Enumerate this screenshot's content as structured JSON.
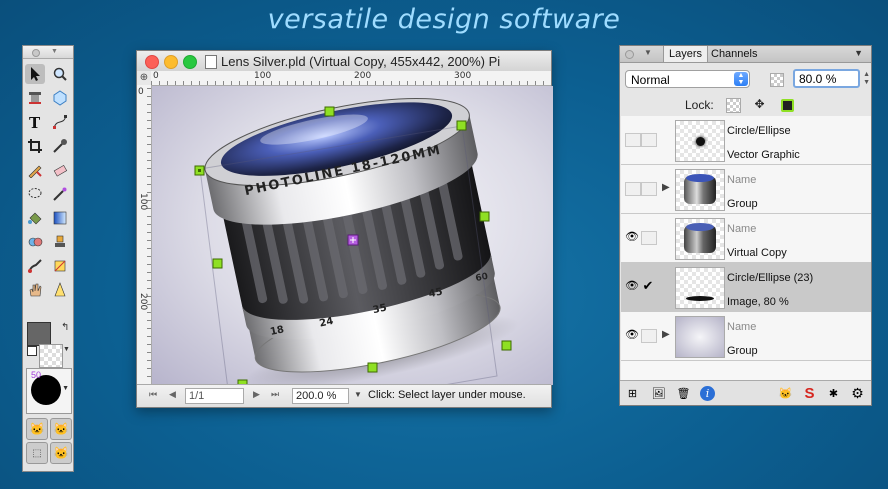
{
  "banner": "versatile design software",
  "toolbox": {
    "brush_size": "50",
    "tools": [
      "arrow-tool",
      "zoom-tool",
      "stamp-tool",
      "shape-tool",
      "text-tool",
      "node-tool",
      "crop-tool",
      "pipette-tool",
      "pencil-tool",
      "eraser-tool",
      "lasso-tool",
      "magic-wand-tool",
      "bucket-tool",
      "gradient-tool",
      "clone-tool",
      "light-tool",
      "brush-tool",
      "smudge-tool",
      "hand-tool",
      "sharpen-tool"
    ]
  },
  "document": {
    "title": "Lens Silver.pld (Virtual Copy, 455x442, 200%) Pi",
    "ruler_h_labels": [
      "0",
      "100",
      "200",
      "300"
    ],
    "ruler_v_labels": [
      "0",
      "100",
      "200"
    ],
    "page": "1/1",
    "zoom": "200.0 %",
    "status": "Click: Select layer under mouse.",
    "lens_brand": "PHOTOLINE 18-120MM",
    "lens_scale": [
      "18",
      "24",
      "35",
      "45",
      "60"
    ]
  },
  "layers_panel": {
    "tabs": [
      "Layers",
      "Channels"
    ],
    "blend_mode": "Normal",
    "opacity": "80.0 %",
    "lock_label": "Lock:",
    "layers": [
      {
        "name": "Circle/Ellipse",
        "type": "Vector Graphic",
        "visible": false,
        "checked": false,
        "group": false,
        "selected": false,
        "name_dim": false
      },
      {
        "name": "Name",
        "type": "Group",
        "visible": false,
        "checked": false,
        "group": true,
        "selected": false,
        "name_dim": true
      },
      {
        "name": "Name",
        "type": "Virtual Copy",
        "visible": true,
        "checked": false,
        "group": false,
        "selected": false,
        "name_dim": true
      },
      {
        "name": "Circle/Ellipse (23)",
        "type": "Image, 80 %",
        "visible": true,
        "checked": true,
        "group": false,
        "selected": true,
        "name_dim": false
      },
      {
        "name": "Name",
        "type": "Group",
        "visible": true,
        "checked": false,
        "group": true,
        "selected": false,
        "name_dim": true
      }
    ]
  }
}
